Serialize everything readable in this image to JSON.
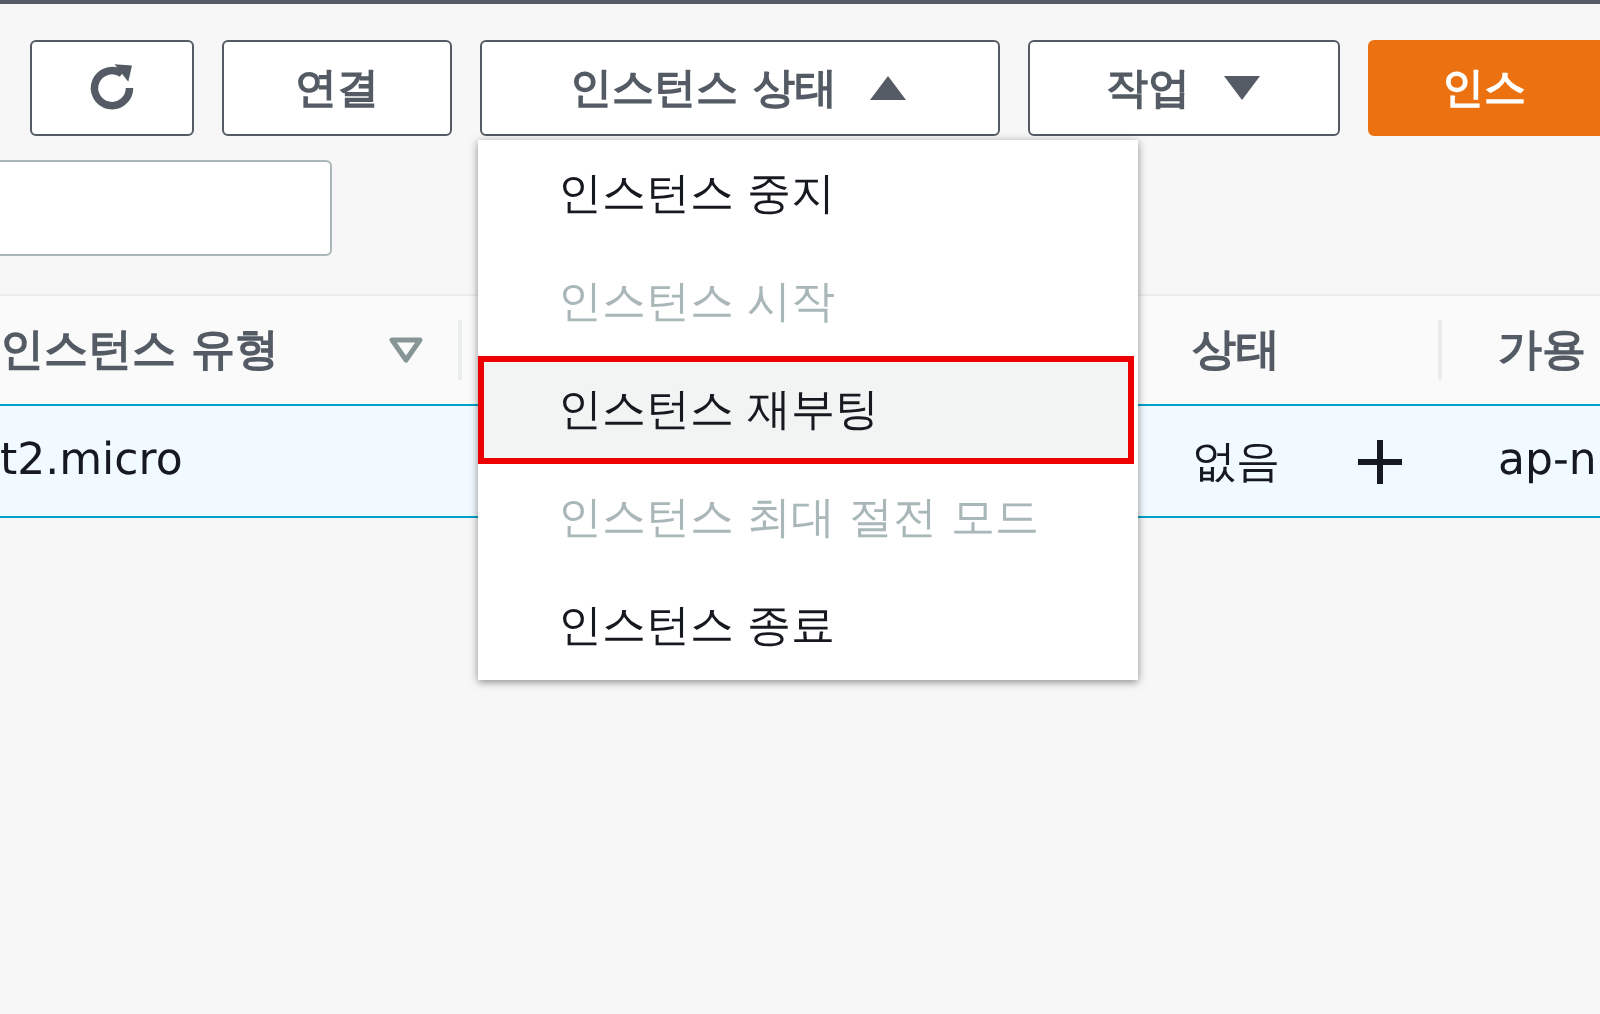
{
  "toolbar": [
    {
      "kind": "refresh"
    },
    {
      "kind": "button",
      "label": "연결"
    },
    {
      "kind": "dropdown",
      "label": "인스턴스 상태",
      "expanded": true
    },
    {
      "kind": "dropdown",
      "label": "작업",
      "expanded": false
    },
    {
      "kind": "primary",
      "label": "인스"
    }
  ],
  "table": {
    "columns": [
      {
        "label": "인스턴스 유형",
        "sortable": true
      },
      {
        "label": "상태"
      },
      {
        "label": "가용"
      }
    ],
    "rows": [
      {
        "selected": true,
        "cells": [
          "t2.micro",
          "없음",
          "ap-n"
        ]
      }
    ]
  },
  "menu": {
    "items": [
      {
        "label": "인스턴스 중지",
        "disabled": false,
        "selected": false
      },
      {
        "label": "인스턴스 시작",
        "disabled": true,
        "selected": false
      },
      {
        "label": "인스턴스 재부팅",
        "disabled": false,
        "selected": true
      },
      {
        "label": "인스턴스 최대 절전 모드",
        "disabled": true,
        "selected": false
      },
      {
        "label": "인스턴스 종료",
        "disabled": false,
        "selected": false
      }
    ]
  }
}
